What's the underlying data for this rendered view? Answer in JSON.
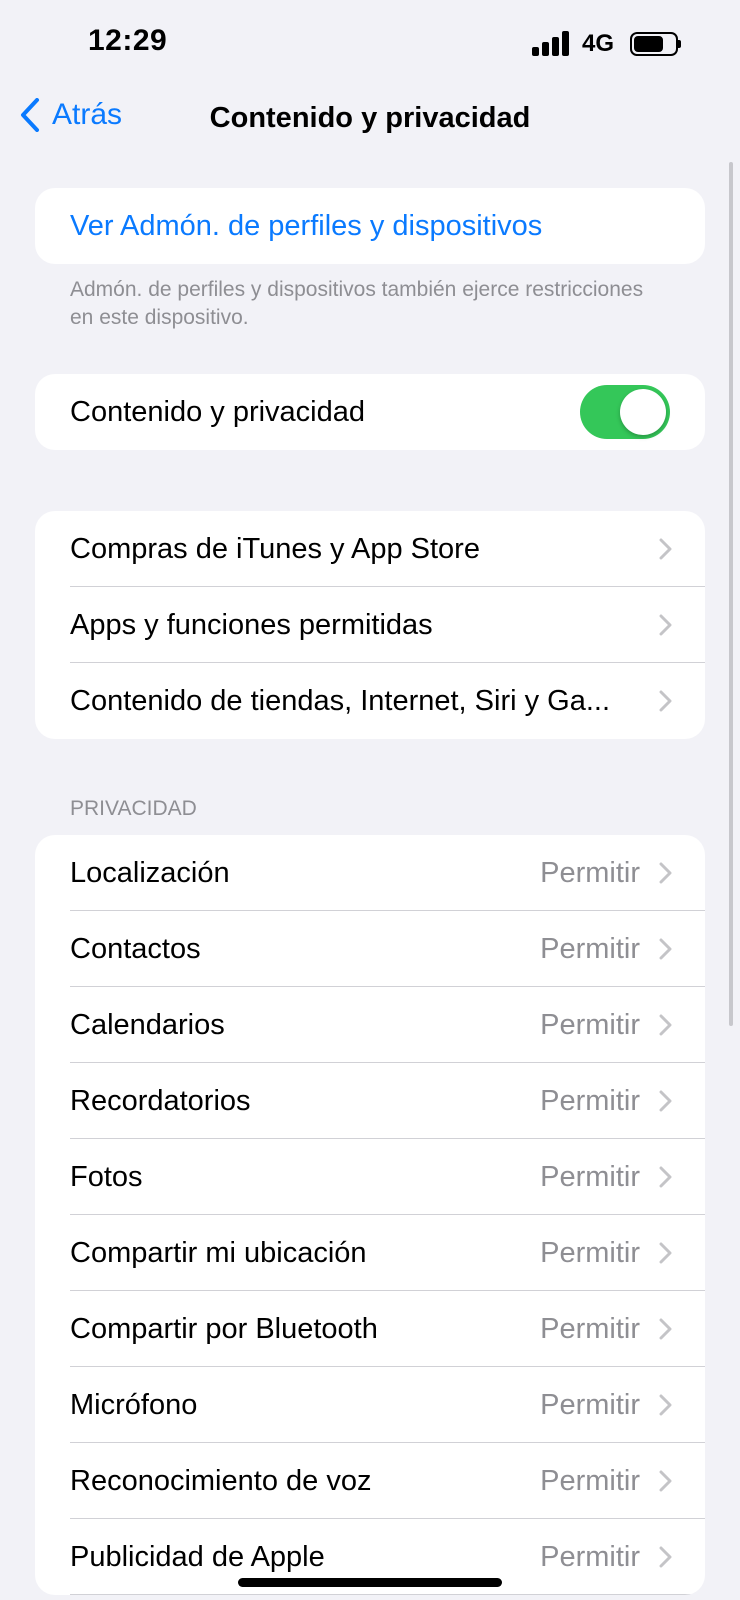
{
  "status_bar": {
    "time": "12:29",
    "network": "4G"
  },
  "nav": {
    "back_label": "Atrás",
    "title": "Contenido y privacidad"
  },
  "profiles_link": {
    "label": "Ver Admón. de perfiles y dispositivos"
  },
  "footnote": "Admón. de perfiles y dispositivos también ejerce restricciones en este dispositivo.",
  "toggle_row": {
    "label": "Contenido y privacidad",
    "enabled": true
  },
  "content_group": [
    {
      "label": "Compras de iTunes y App Store"
    },
    {
      "label": "Apps y funciones permitidas"
    },
    {
      "label": "Contenido de tiendas, Internet, Siri y Ga..."
    }
  ],
  "privacy": {
    "header": "PRIVACIDAD",
    "items": [
      {
        "label": "Localización",
        "value": "Permitir"
      },
      {
        "label": "Contactos",
        "value": "Permitir"
      },
      {
        "label": "Calendarios",
        "value": "Permitir"
      },
      {
        "label": "Recordatorios",
        "value": "Permitir"
      },
      {
        "label": "Fotos",
        "value": "Permitir"
      },
      {
        "label": "Compartir mi ubicación",
        "value": "Permitir"
      },
      {
        "label": "Compartir por Bluetooth",
        "value": "Permitir"
      },
      {
        "label": "Micrófono",
        "value": "Permitir"
      },
      {
        "label": "Reconocimiento de voz",
        "value": "Permitir"
      },
      {
        "label": "Publicidad de Apple",
        "value": "Permitir"
      }
    ]
  },
  "colors": {
    "accent": "#0a7aff",
    "toggle_on": "#34c759",
    "background": "#f2f2f7",
    "secondary_text": "#8e8e93"
  },
  "icons": {
    "back": "chevron-left-icon",
    "disclosure": "chevron-right-icon"
  }
}
